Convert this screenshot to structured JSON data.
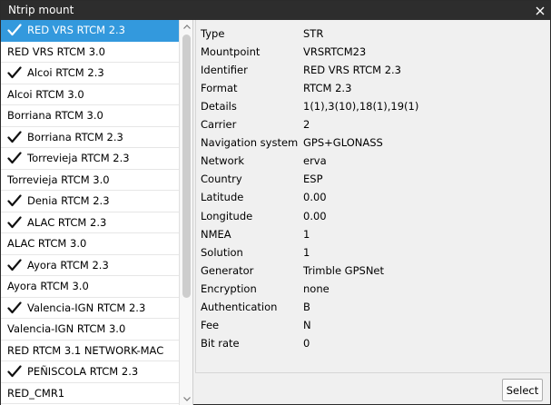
{
  "window": {
    "title": "Ntrip mount"
  },
  "mountpoints": [
    {
      "label": "RED VRS RTCM 2.3",
      "checked": true,
      "selected": true
    },
    {
      "label": "RED VRS RTCM 3.0",
      "checked": false
    },
    {
      "label": "Alcoi RTCM 2.3",
      "checked": true
    },
    {
      "label": "Alcoi RTCM 3.0",
      "checked": false
    },
    {
      "label": "Borriana RTCM 3.0",
      "checked": false
    },
    {
      "label": "Borriana RTCM 2.3",
      "checked": true
    },
    {
      "label": "Torrevieja RTCM 2.3",
      "checked": true
    },
    {
      "label": "Torrevieja RTCM 3.0",
      "checked": false
    },
    {
      "label": "Denia RTCM 2.3",
      "checked": true
    },
    {
      "label": "ALAC RTCM 2.3",
      "checked": true
    },
    {
      "label": "ALAC RTCM 3.0",
      "checked": false
    },
    {
      "label": "Ayora RTCM 2.3",
      "checked": true
    },
    {
      "label": "Ayora RTCM 3.0",
      "checked": false
    },
    {
      "label": "Valencia-IGN RTCM 2.3",
      "checked": true
    },
    {
      "label": "Valencia-IGN RTCM 3.0",
      "checked": false
    },
    {
      "label": "RED RTCM 3.1 NETWORK-MAC",
      "checked": false
    },
    {
      "label": "PEÑISCOLA RTCM 2.3",
      "checked": true
    },
    {
      "label": "RED_CMR1",
      "checked": false
    }
  ],
  "details": [
    {
      "key": "Type",
      "value": "STR"
    },
    {
      "key": "Mountpoint",
      "value": "VRSRTCM23"
    },
    {
      "key": "Identifier",
      "value": "RED VRS RTCM 2.3"
    },
    {
      "key": "Format",
      "value": "RTCM 2.3"
    },
    {
      "key": "Details",
      "value": "1(1),3(10),18(1),19(1)"
    },
    {
      "key": "Carrier",
      "value": "2"
    },
    {
      "key": "Navigation system",
      "value": "GPS+GLONASS"
    },
    {
      "key": "Network",
      "value": "erva"
    },
    {
      "key": "Country",
      "value": "ESP"
    },
    {
      "key": "Latitude",
      "value": "0.00"
    },
    {
      "key": "Longitude",
      "value": "0.00"
    },
    {
      "key": "NMEA",
      "value": "1"
    },
    {
      "key": "Solution",
      "value": "1"
    },
    {
      "key": "Generator",
      "value": "Trimble GPSNet"
    },
    {
      "key": "Encryption",
      "value": "none"
    },
    {
      "key": "Authentication",
      "value": "B"
    },
    {
      "key": "Fee",
      "value": "N"
    },
    {
      "key": "Bit rate",
      "value": "0"
    }
  ],
  "buttons": {
    "select_label": "Select"
  },
  "icons": {
    "close": "close-icon",
    "check": "checkmark-icon",
    "scroll_up": "chevron-up-icon",
    "scroll_down": "chevron-down-icon"
  },
  "colors": {
    "titlebar": "#2d2d2d",
    "selection": "#3399dd"
  }
}
